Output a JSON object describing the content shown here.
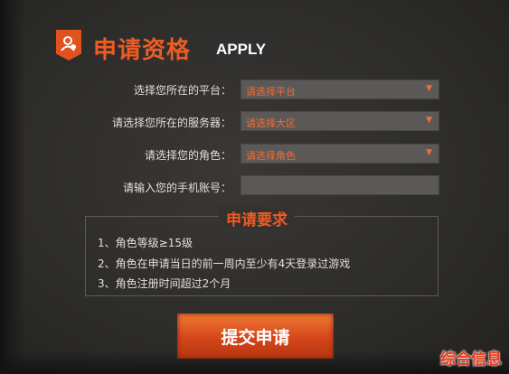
{
  "header": {
    "title": "申请资格",
    "title_en": "APPLY",
    "icon": "user-badge-icon"
  },
  "form": {
    "fields": [
      {
        "label": "选择您所在的平台：",
        "value": "请选择平台"
      },
      {
        "label": "请选择您所在的服务器：",
        "value": "请选择大区"
      },
      {
        "label": "请选择您的角色：",
        "value": "请选择角色"
      },
      {
        "label": "请输入您的手机账号：",
        "value": ""
      }
    ]
  },
  "requirements": {
    "title": "申请要求",
    "items": [
      "1、角色等级≥15级",
      "2、角色在申请当日的前一周内至少有4天登录过游戏",
      "3、角色注册时间超过2个月"
    ]
  },
  "submit": {
    "label": "提交申请"
  },
  "watermark": "综合信息",
  "colors": {
    "accent": "#ef5a24",
    "field_bg": "#5b5957",
    "field_text": "#ee6e3a",
    "panel_bg": "#2e2d2b"
  }
}
